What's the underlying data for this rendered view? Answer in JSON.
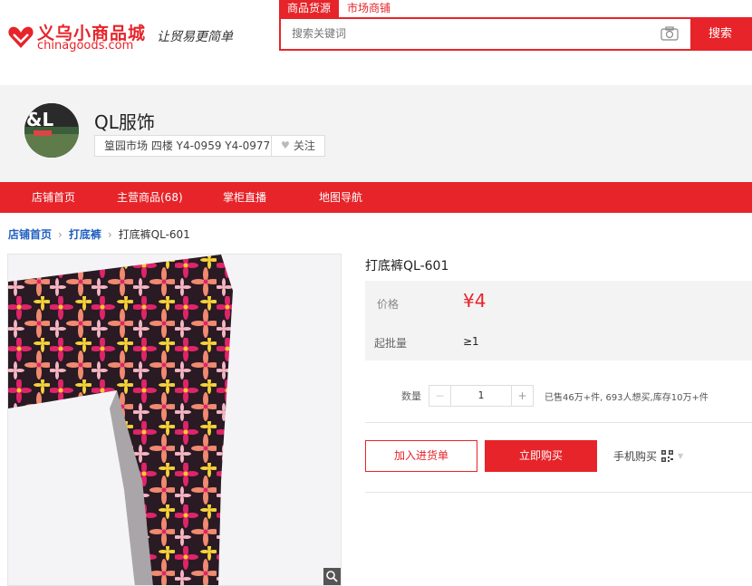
{
  "header": {
    "logo_cn": "义乌小商品城",
    "logo_en": "chinagoods.com",
    "slogan": "让贸易更简单",
    "search_tabs": [
      "商品货源",
      "市场商铺"
    ],
    "search_placeholder": "搜索关键词",
    "search_button": "搜索"
  },
  "shop": {
    "name": "QL服饰",
    "location": "篁园市场 四楼 Y4-0959 Y4-0977",
    "follow_label": "关注",
    "avatar_text": "&L"
  },
  "nav": {
    "items": [
      "店铺首页",
      "主营商品(68)",
      "掌柜直播",
      "地图导航"
    ]
  },
  "breadcrumb": {
    "items": [
      "店铺首页",
      "打底裤",
      "打底裤QL-601"
    ]
  },
  "product": {
    "title": "打底裤QL-601",
    "price_label": "价格",
    "price": "¥4",
    "moq_label": "起批量",
    "moq": "≥1",
    "qty_label": "数量",
    "qty_minus": "−",
    "qty_plus": "+",
    "qty_value": "1",
    "sales_info": "已售46万+件, 693人想买,库存10万+件",
    "add_cart": "加入进货单",
    "buy_now": "立即购买",
    "mobile_buy": "手机购买"
  },
  "colors": {
    "brand": "#e6242a",
    "link": "#1f5fbf"
  }
}
